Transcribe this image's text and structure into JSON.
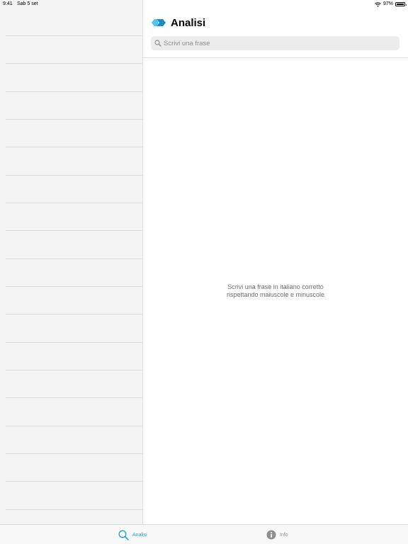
{
  "status_bar": {
    "time": "9:41",
    "date": "Sab 5 set",
    "battery_text": "97%",
    "battery_level": 0.97,
    "icons": [
      "wifi-icon",
      "battery-icon"
    ]
  },
  "header": {
    "title": "Analisi",
    "logo": "app-logo-icon"
  },
  "search": {
    "placeholder": "Scrivi una frase",
    "value": "",
    "icon": "search-icon"
  },
  "empty_state": {
    "line1": "Scrivi una frase in italiano corretto",
    "line2": "rispettando maiuscole e minuscole"
  },
  "tab_bar": {
    "tabs": [
      {
        "label": "Analisi",
        "icon": "search-icon",
        "selected": true
      },
      {
        "label": "Info",
        "icon": "info-icon",
        "selected": false
      }
    ]
  },
  "colors": {
    "accent": "#2a9fd8",
    "sidebar_bg": "#f4f4f4",
    "search_bg": "#ececed",
    "text_secondary": "#6d6d72",
    "inactive_tab": "#8e8e93"
  }
}
